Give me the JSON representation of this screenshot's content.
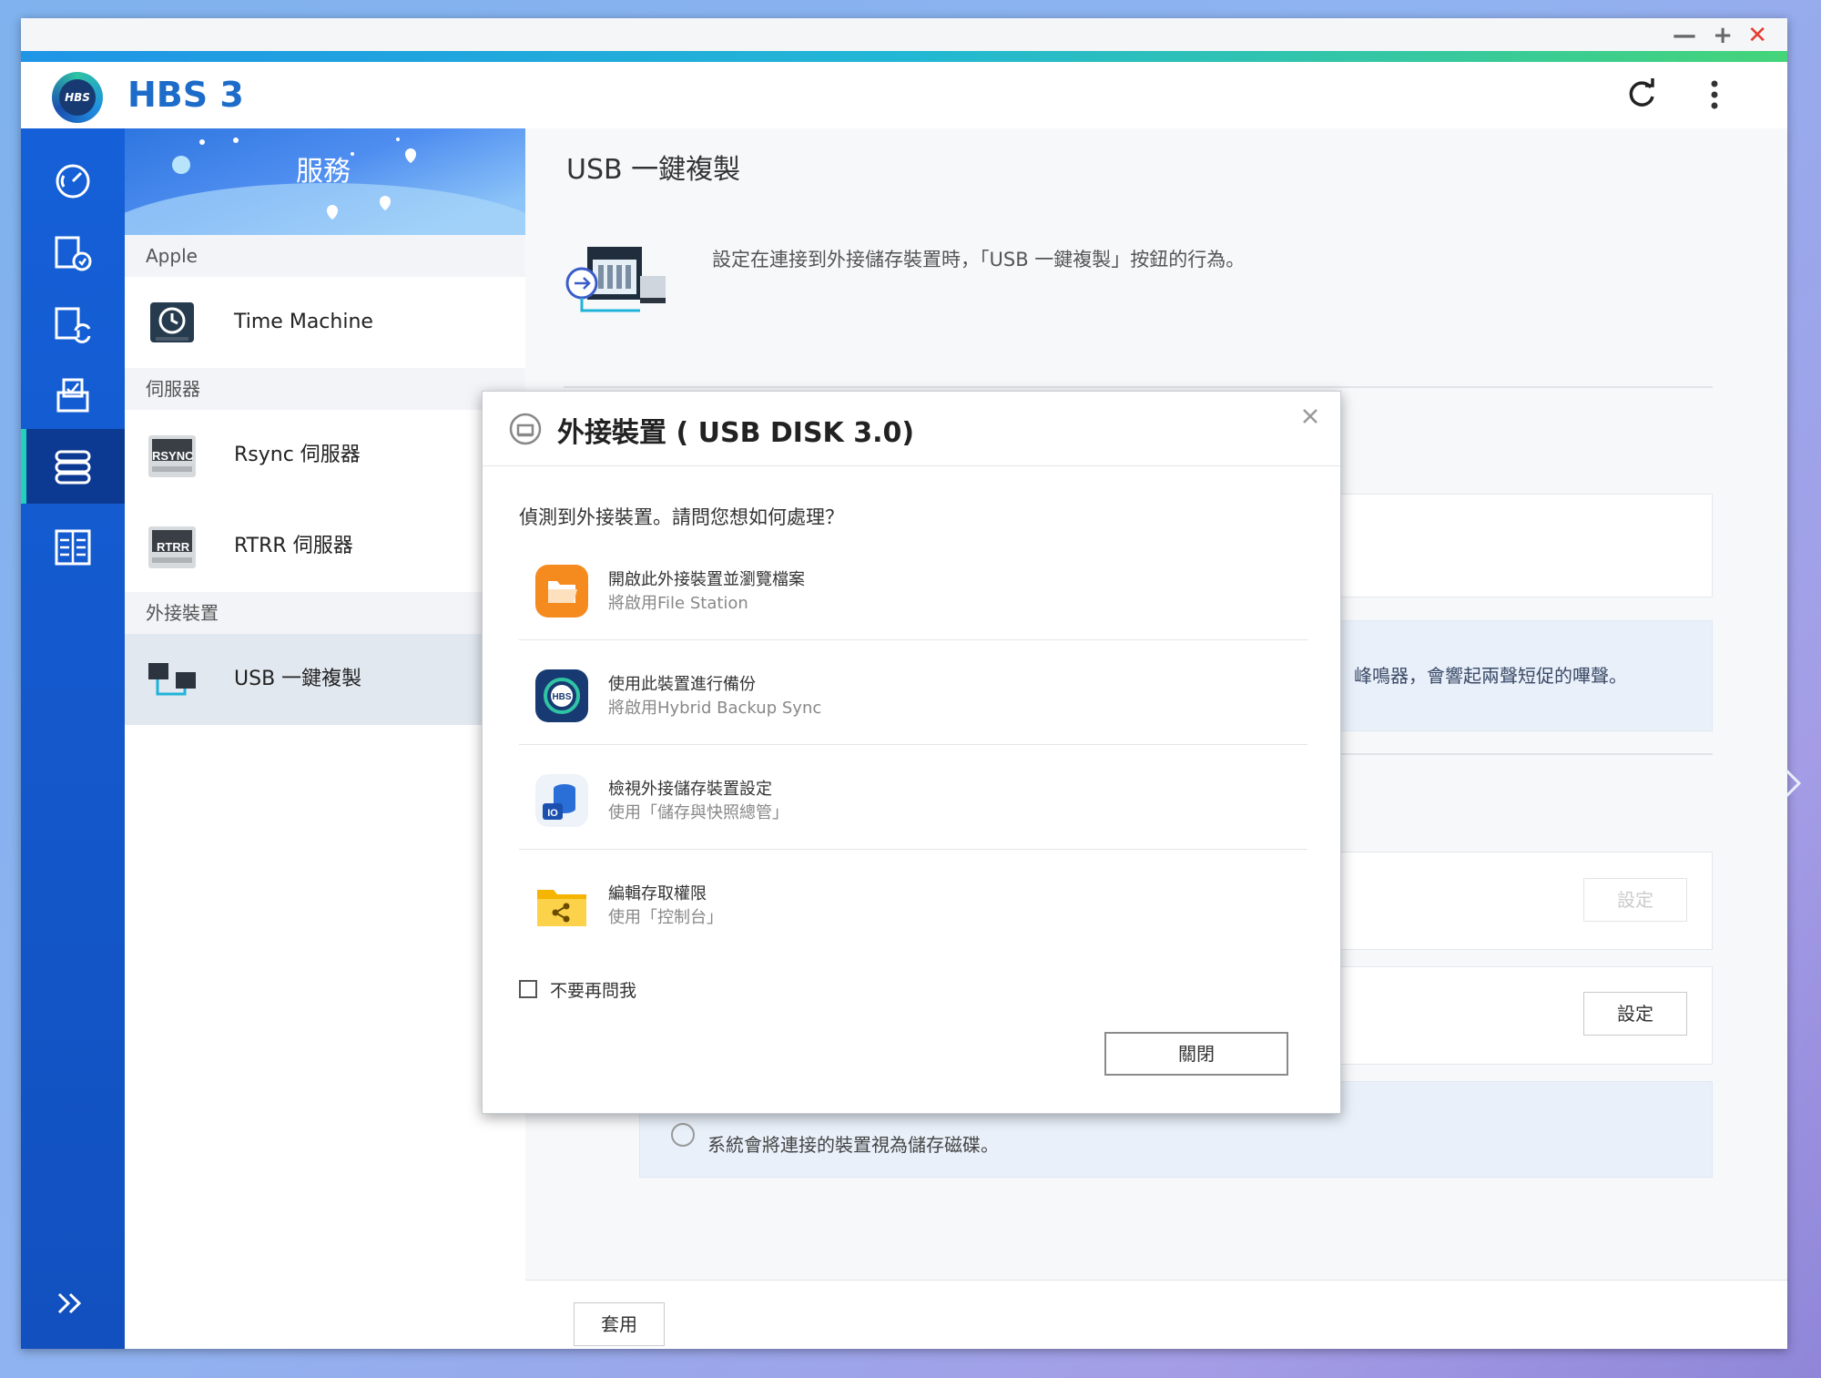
{
  "app": {
    "title": "HBS 3",
    "logo_text": "HBS"
  },
  "window_controls": {
    "minimize": "—",
    "maximize": "+",
    "close": "✕"
  },
  "services": {
    "banner_title": "服務",
    "sections": [
      {
        "label": "Apple",
        "items": [
          {
            "label": "Time Machine",
            "icon": "time-machine-icon"
          }
        ]
      },
      {
        "label": "伺服器",
        "items": [
          {
            "label": "Rsync 伺服器",
            "icon": "rsync-icon",
            "badge": "RSYNC"
          },
          {
            "label": "RTRR 伺服器",
            "icon": "rtrr-icon",
            "badge": "RTRR"
          }
        ]
      },
      {
        "label": "外接裝置",
        "items": [
          {
            "label": "USB 一鍵複製",
            "icon": "usb-copy-icon",
            "active": true
          }
        ]
      }
    ]
  },
  "main": {
    "title": "USB 一鍵複製",
    "description": "設定在連接到外接儲存裝置時，「USB 一鍵複製」按鈕的行為。",
    "note_beep": "峰鳴器，會響起兩聲短促的嗶聲。",
    "note_storage": "系統會將連接的裝置視為儲存磁碟。",
    "setting_btn": "設定",
    "apply_btn": "套用"
  },
  "dialog": {
    "title": "外接裝置 ( USB DISK 3.0)",
    "question": "偵測到外接裝置。請問您想如何處理？",
    "options": [
      {
        "title": "開啟此外接裝置並瀏覽檔案",
        "subtitle": "將啟用File Station",
        "icon": "file-station-icon"
      },
      {
        "title": "使用此裝置進行備份",
        "subtitle": "將啟用Hybrid Backup Sync",
        "icon": "hbs-icon"
      },
      {
        "title": "檢視外接儲存裝置設定",
        "subtitle": "使用「儲存與快照總管」",
        "icon": "storage-snapshots-icon"
      },
      {
        "title": "編輯存取權限",
        "subtitle": "使用「控制台」",
        "icon": "control-panel-icon"
      }
    ],
    "dont_ask": "不要再問我",
    "close_btn": "關閉"
  },
  "colors": {
    "accent_blue": "#1d6cc9",
    "sidebar_blue": "#1560d8",
    "active_teal": "#22d0bd",
    "close_red": "#e63b2e"
  }
}
